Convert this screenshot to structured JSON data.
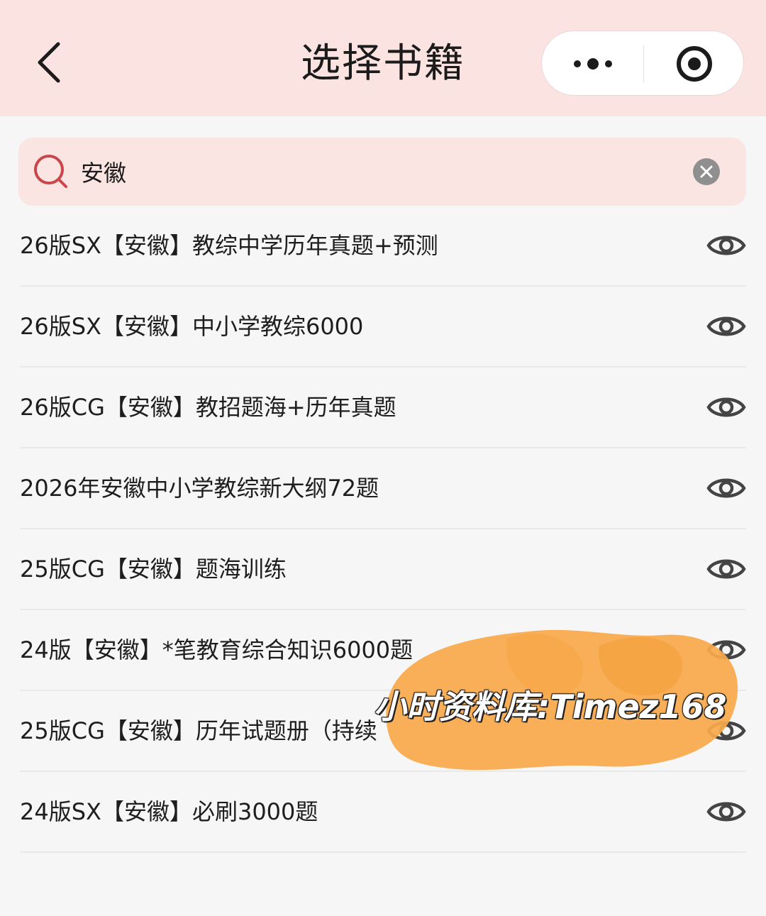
{
  "header": {
    "title": "选择书籍"
  },
  "search": {
    "value": "安徽"
  },
  "books": [
    {
      "title": "26版SX【安徽】教综中学历年真题+预测"
    },
    {
      "title": "26版SX【安徽】中小学教综6000"
    },
    {
      "title": "26版CG【安徽】教招题海+历年真题"
    },
    {
      "title": "2026年安徽中小学教综新大纲72题"
    },
    {
      "title": "25版CG【安徽】题海训练"
    },
    {
      "title": "24版【安徽】*笔教育综合知识6000题"
    },
    {
      "title": "25版CG【安徽】历年试题册（持续"
    },
    {
      "title": "24版SX【安徽】必刷3000题"
    }
  ],
  "watermark": {
    "text": "小时资料库:Timez168"
  },
  "colors": {
    "header_bg": "#fbe3e2",
    "search_bg": "#fbe5e3",
    "search_icon": "#c9474a",
    "page_bg": "#f6f6f6",
    "watermark_orange": "#f7a94a"
  },
  "icons": {
    "back": "chevron-left-icon",
    "more": "more-dots-icon",
    "close": "target-close-icon",
    "search": "search-icon",
    "clear": "clear-circle-icon",
    "view": "eye-icon"
  }
}
